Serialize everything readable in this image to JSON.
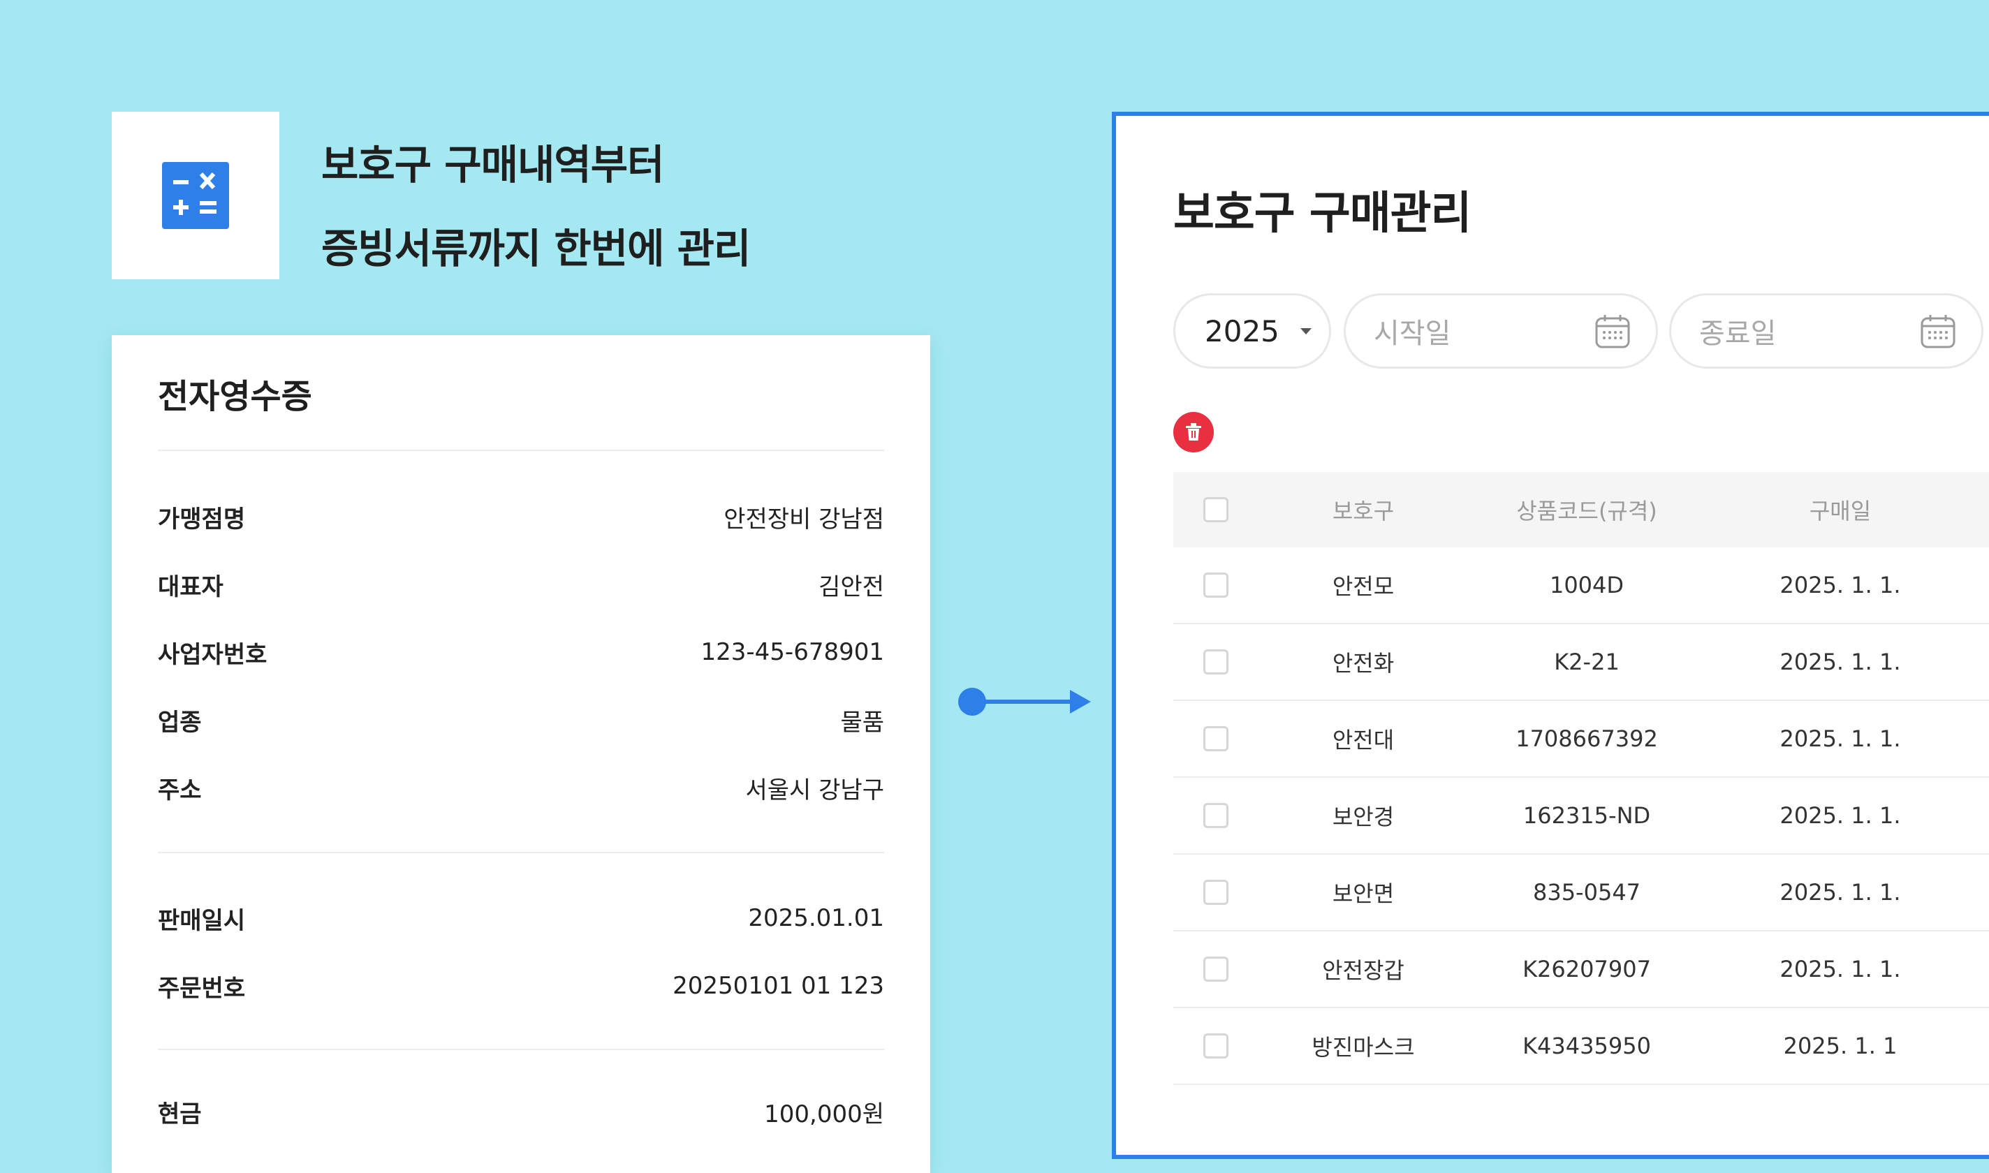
{
  "headline": {
    "line1": "보호구 구매내역부터",
    "line2": "증빙서류까지 한번에 관리"
  },
  "logo": {
    "icon": "calculator-icon",
    "color": "#2f7fe8"
  },
  "receipt": {
    "title": "전자영수증",
    "store_rows": [
      {
        "label": "가맹점명",
        "value": "안전장비 강남점"
      },
      {
        "label": "대표자",
        "value": "김안전"
      },
      {
        "label": "사업자번호",
        "value": "123-45-678901"
      },
      {
        "label": "업종",
        "value": "물품"
      },
      {
        "label": "주소",
        "value": "서울시 강남구"
      }
    ],
    "order_rows": [
      {
        "label": "판매일시",
        "value": "2025.01.01"
      },
      {
        "label": "주문번호",
        "value": "20250101 01 123"
      }
    ],
    "payment_rows": [
      {
        "label": "현금",
        "value": "100,000원"
      }
    ]
  },
  "panel": {
    "title": "보호구 구매관리",
    "accent_color": "#2f7fe8",
    "filters": {
      "year": "2025",
      "start_placeholder": "시작일",
      "end_placeholder": "종료일"
    },
    "delete_color": "#e83040",
    "table": {
      "headers": [
        "보호구",
        "상품코드(규격)",
        "구매일"
      ],
      "rows": [
        {
          "name": "안전모",
          "code": "1004D",
          "date": "2025. 1. 1."
        },
        {
          "name": "안전화",
          "code": "K2-21",
          "date": "2025. 1. 1."
        },
        {
          "name": "안전대",
          "code": "1708667392",
          "date": "2025. 1. 1."
        },
        {
          "name": "보안경",
          "code": "162315-ND",
          "date": "2025. 1. 1."
        },
        {
          "name": "보안면",
          "code": "835-0547",
          "date": "2025. 1. 1."
        },
        {
          "name": "안전장갑",
          "code": "K26207907",
          "date": "2025. 1. 1."
        },
        {
          "name": "방진마스크",
          "code": "K43435950",
          "date": "2025. 1. 1"
        }
      ]
    }
  }
}
